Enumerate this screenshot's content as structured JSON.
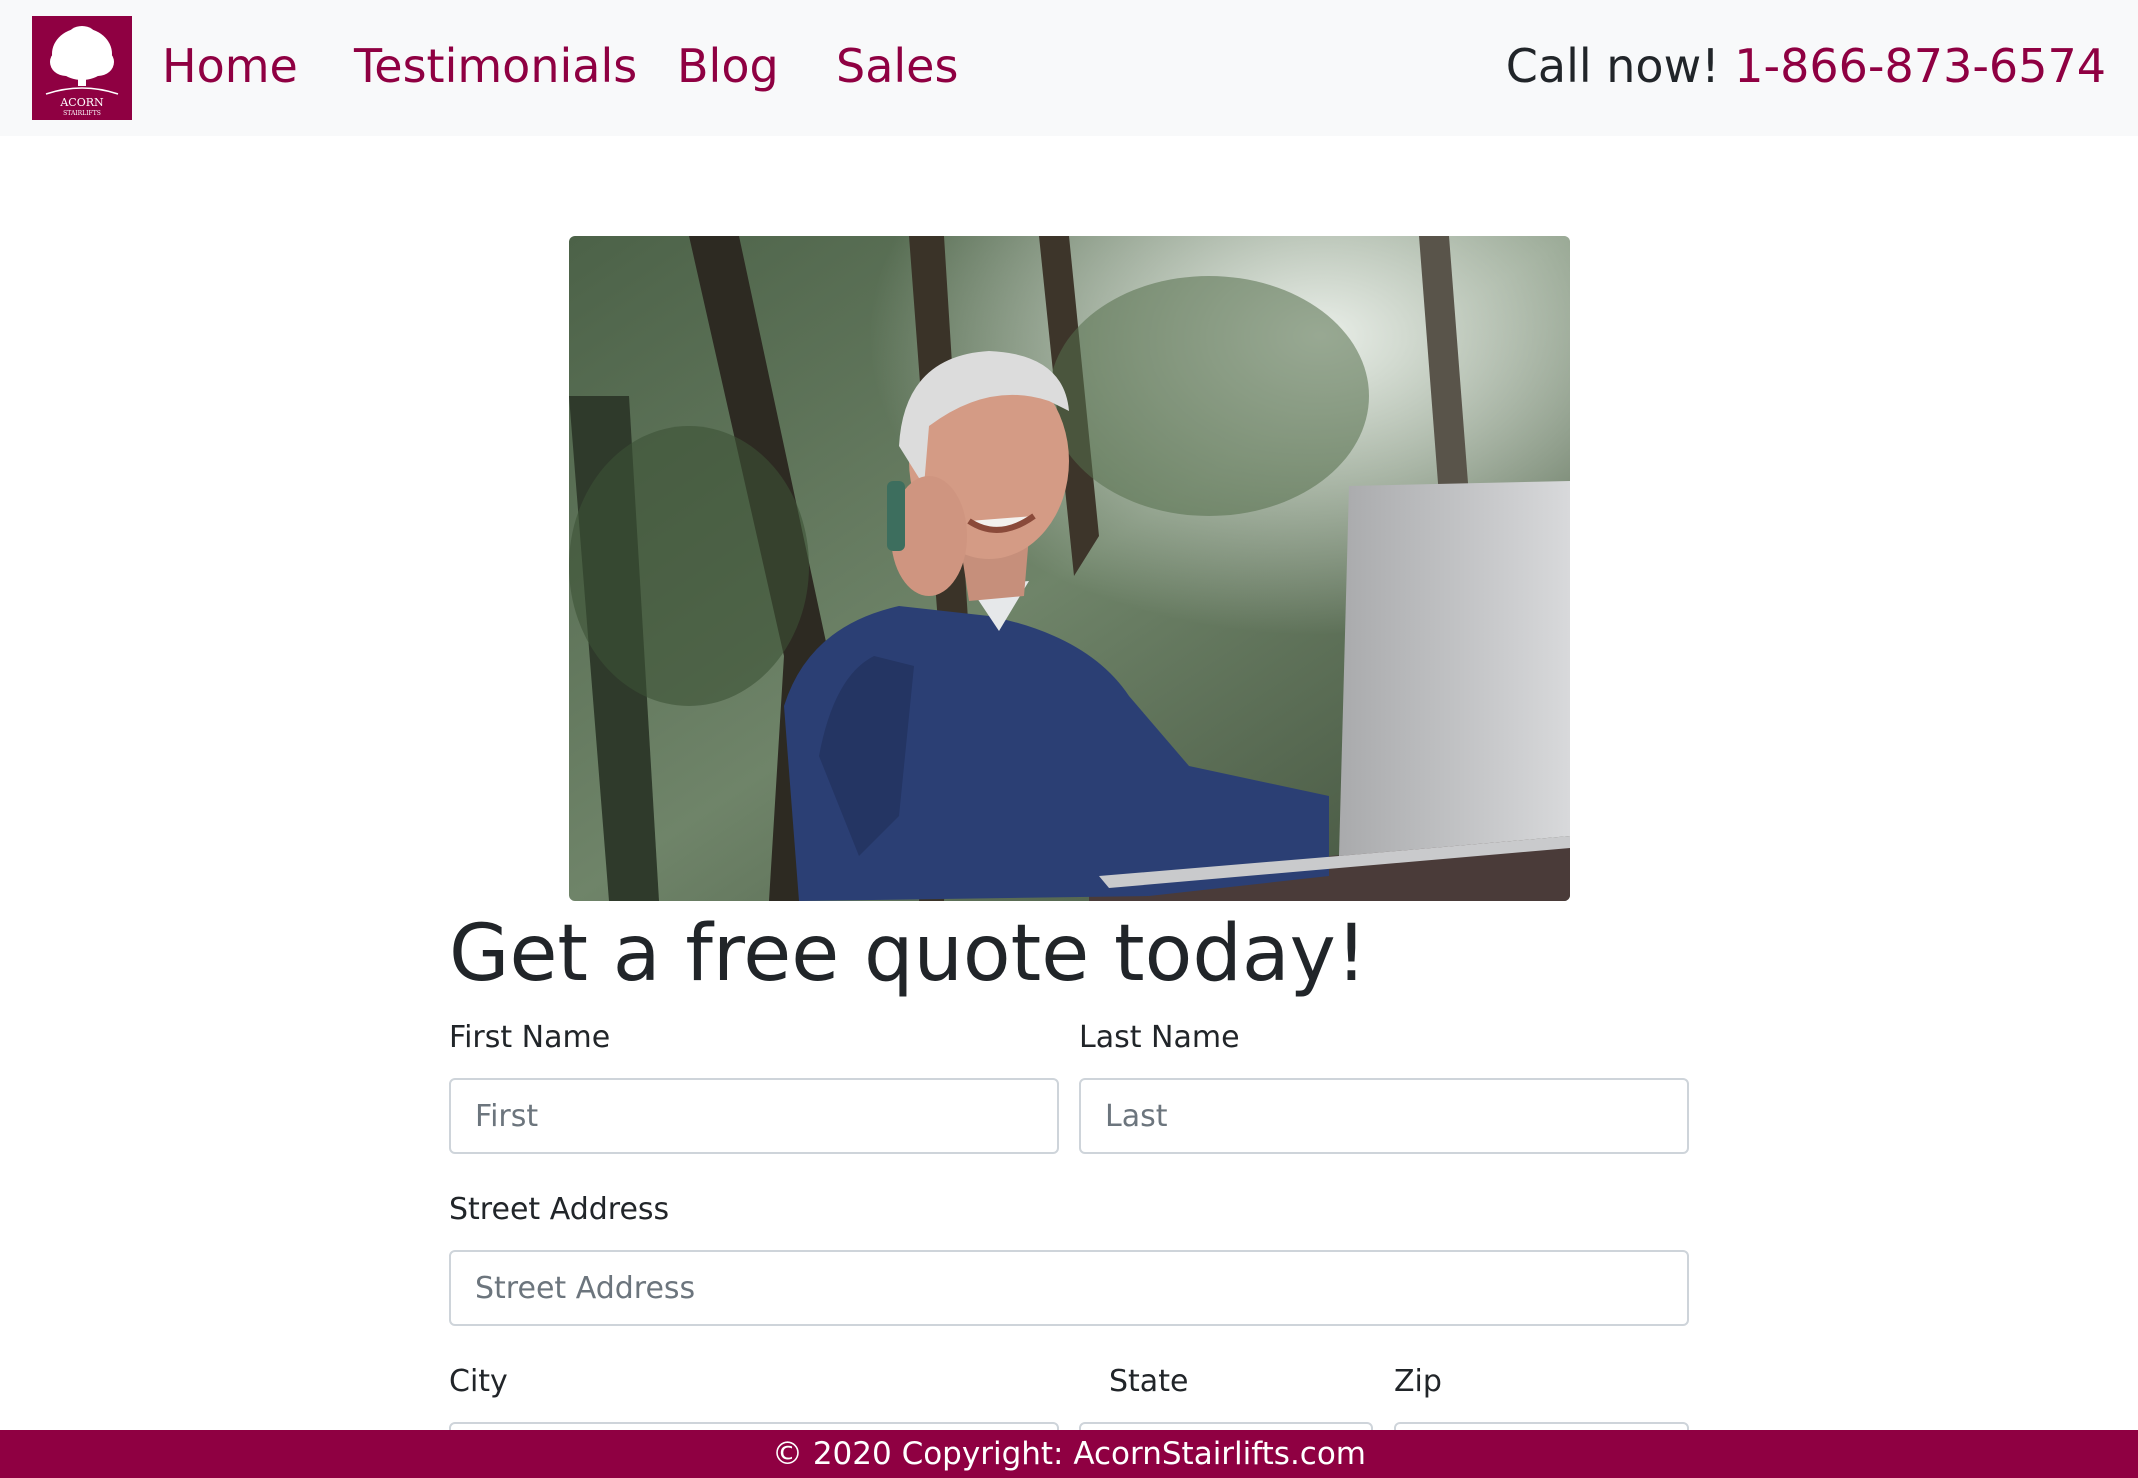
{
  "header": {
    "logo": {
      "name": "ACORN",
      "tagline": "STAIRLIFTS"
    },
    "nav": [
      {
        "label": "Home"
      },
      {
        "label": "Testimonials"
      },
      {
        "label": "Blog"
      },
      {
        "label": "Sales"
      }
    ],
    "call_prefix": "Call now!",
    "phone": "1-866-873-6574"
  },
  "hero": {
    "image_subject": "smiling man on phone with laptop outdoors"
  },
  "form": {
    "title": "Get a free quote today!",
    "first_name": {
      "label": "First Name",
      "placeholder": "First",
      "value": ""
    },
    "last_name": {
      "label": "Last Name",
      "placeholder": "Last",
      "value": ""
    },
    "street": {
      "label": "Street Address",
      "placeholder": "Street Address",
      "value": ""
    },
    "city": {
      "label": "City",
      "placeholder": "",
      "value": ""
    },
    "state": {
      "label": "State",
      "placeholder": "",
      "value": ""
    },
    "zip": {
      "label": "Zip",
      "placeholder": "",
      "value": ""
    }
  },
  "footer": {
    "copyright": "© 2020 Copyright: AcornStairlifts.com"
  },
  "colors": {
    "brand": "#8f0042",
    "navbar_bg": "#f8f9fa",
    "text": "#212529",
    "input_border": "#ced4da"
  }
}
